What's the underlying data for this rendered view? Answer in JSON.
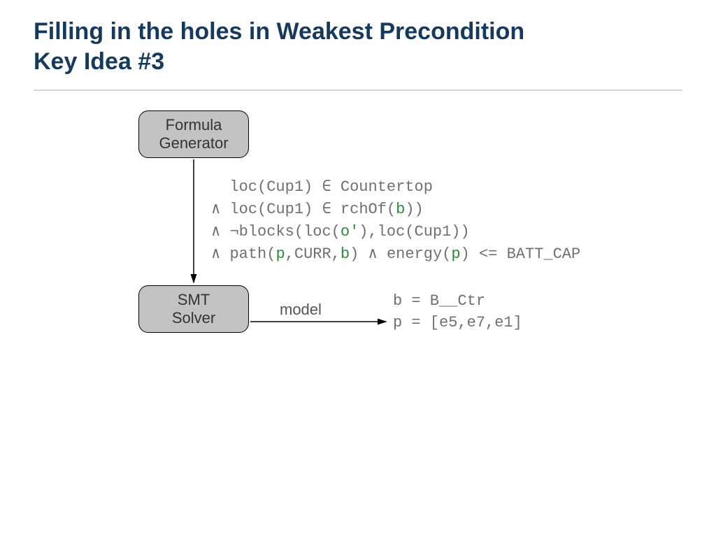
{
  "title": {
    "line1": "Filling in the holes in Weakest Precondition",
    "line2": "Key Idea #3"
  },
  "nodes": {
    "formula_generator": "Formula\nGenerator",
    "smt_solver": "SMT\nSolver"
  },
  "code": {
    "l1_a": "  loc(Cup1) ∈ Countertop",
    "l2_a": "∧ loc(Cup1) ∈ rchOf(",
    "l2_b": "b",
    "l2_c": "))",
    "l3_a": "∧ ¬blocks(loc(",
    "l3_b": "o'",
    "l3_c": "),loc(Cup1))",
    "l4_a": "∧ path(",
    "l4_b": "p",
    "l4_c": ",CURR,",
    "l4_d": "b",
    "l4_e": ") ∧ energy(",
    "l4_f": "p",
    "l4_g": ") <= BATT_CAP"
  },
  "model_label": "model",
  "model_output": {
    "l1": "b = B__Ctr",
    "l2": "p = [e5,e7,e1]"
  },
  "colors": {
    "title": "#153a5e",
    "node_bg": "#c3c3c3",
    "code_gray": "#707070",
    "highlight_green": "#2e8a3a"
  }
}
